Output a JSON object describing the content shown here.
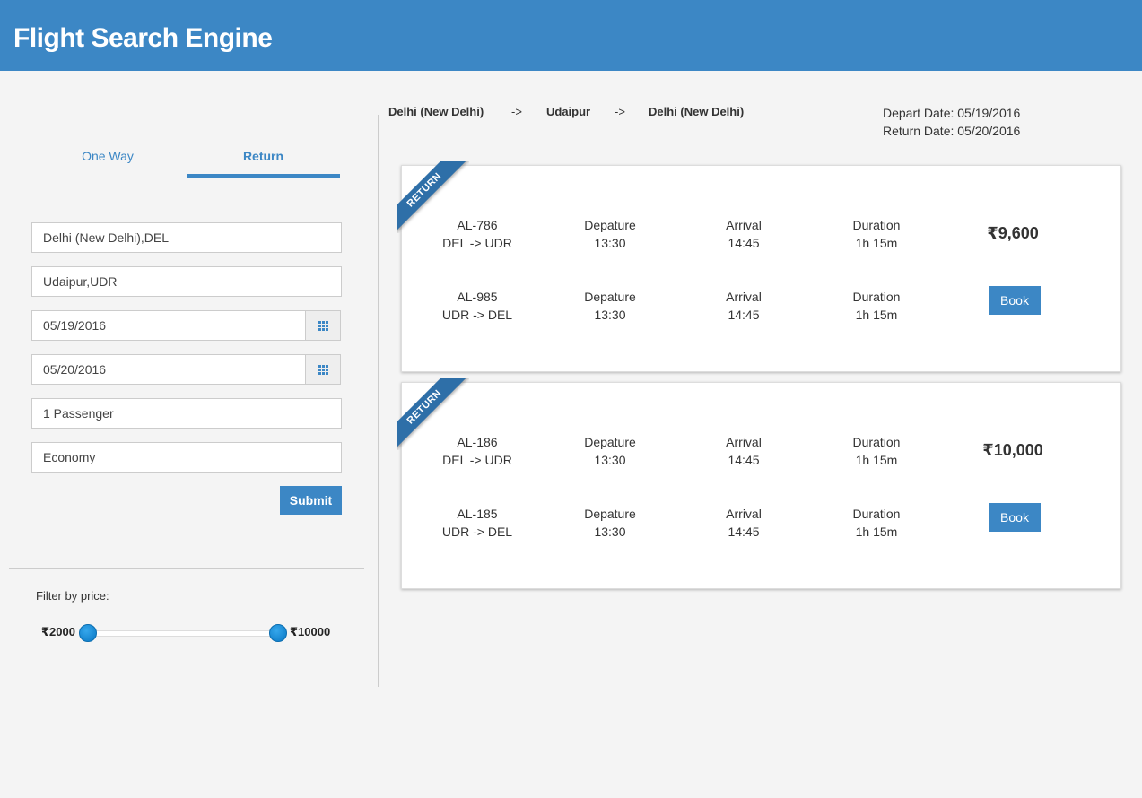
{
  "app": {
    "title": "Flight Search Engine"
  },
  "tabs": [
    {
      "label": "One Way"
    },
    {
      "label": "Return"
    }
  ],
  "form": {
    "origin": "Delhi (New Delhi),DEL",
    "destination": "Udaipur,UDR",
    "depart_date": "05/19/2016",
    "return_date": "05/20/2016",
    "passengers": "1 Passenger",
    "cabin_class": "Economy",
    "submit_label": "Submit"
  },
  "filter": {
    "label": "Filter by price:",
    "min_label": "₹2000",
    "max_label": "₹10000",
    "range_fraction": [
      0.0,
      1.0
    ]
  },
  "results_header": {
    "origin": "Delhi (New Delhi)",
    "via": "Udaipur",
    "return_to": "Delhi (New Delhi)",
    "arrow": "->",
    "depart_date": "Depart Date: 05/19/2016",
    "return_date": "Return Date: 05/20/2016"
  },
  "results": [
    {
      "ribbon": "RETURN",
      "price": "₹9,600",
      "book_label": "Book",
      "legs": [
        {
          "flight": "AL-786",
          "route": "DEL -> UDR",
          "dep_label": "Depature",
          "dep_time": "13:30",
          "arr_label": "Arrival",
          "arr_time": "14:45",
          "dur_label": "Duration",
          "duration": "1h 15m"
        },
        {
          "flight": "AL-985",
          "route": "UDR -> DEL",
          "dep_label": "Depature",
          "dep_time": "13:30",
          "arr_label": "Arrival",
          "arr_time": "14:45",
          "dur_label": "Duration",
          "duration": "1h 15m"
        }
      ]
    },
    {
      "ribbon": "RETURN",
      "price": "₹10,000",
      "book_label": "Book",
      "legs": [
        {
          "flight": "AL-186",
          "route": "DEL -> UDR",
          "dep_label": "Depature",
          "dep_time": "13:30",
          "arr_label": "Arrival",
          "arr_time": "14:45",
          "dur_label": "Duration",
          "duration": "1h 15m"
        },
        {
          "flight": "AL-185",
          "route": "UDR -> DEL",
          "dep_label": "Depature",
          "dep_time": "13:30",
          "arr_label": "Arrival",
          "arr_time": "14:45",
          "dur_label": "Duration",
          "duration": "1h 15m"
        }
      ]
    }
  ]
}
